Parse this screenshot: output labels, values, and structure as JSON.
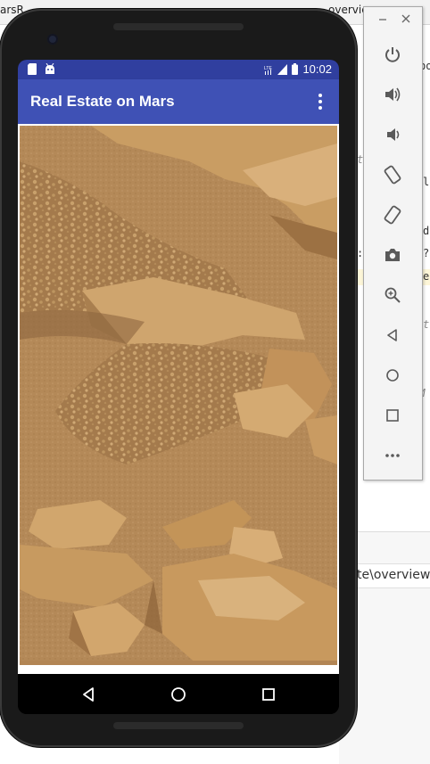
{
  "ide": {
    "tabs": [
      "arsR",
      "overvie"
    ],
    "code_fragments": [
      "bo",
      "t i",
      "le",
      "d",
      ":",
      "?",
      "e",
      "t",
      "yM"
    ],
    "path_text": "te\\overview"
  },
  "app": {
    "title": "Real Estate on Mars",
    "status_time": "10:02",
    "status_network": "LTE",
    "colors": {
      "primary": "#3f51b5",
      "primary_dark": "#303f9f",
      "mars_sand": "#c79a60"
    }
  },
  "photo": {
    "subject": "mars-surface-rocks"
  },
  "nav_bar": {
    "buttons": [
      "back-icon",
      "home-icon",
      "recents-icon"
    ]
  },
  "emulator_toolbar": {
    "buttons": [
      "power-icon",
      "volume-up-icon",
      "volume-down-icon",
      "rotate-left-icon",
      "rotate-right-icon",
      "camera-icon",
      "zoom-icon",
      "back-icon",
      "home-icon",
      "overview-icon",
      "more-icon"
    ]
  }
}
